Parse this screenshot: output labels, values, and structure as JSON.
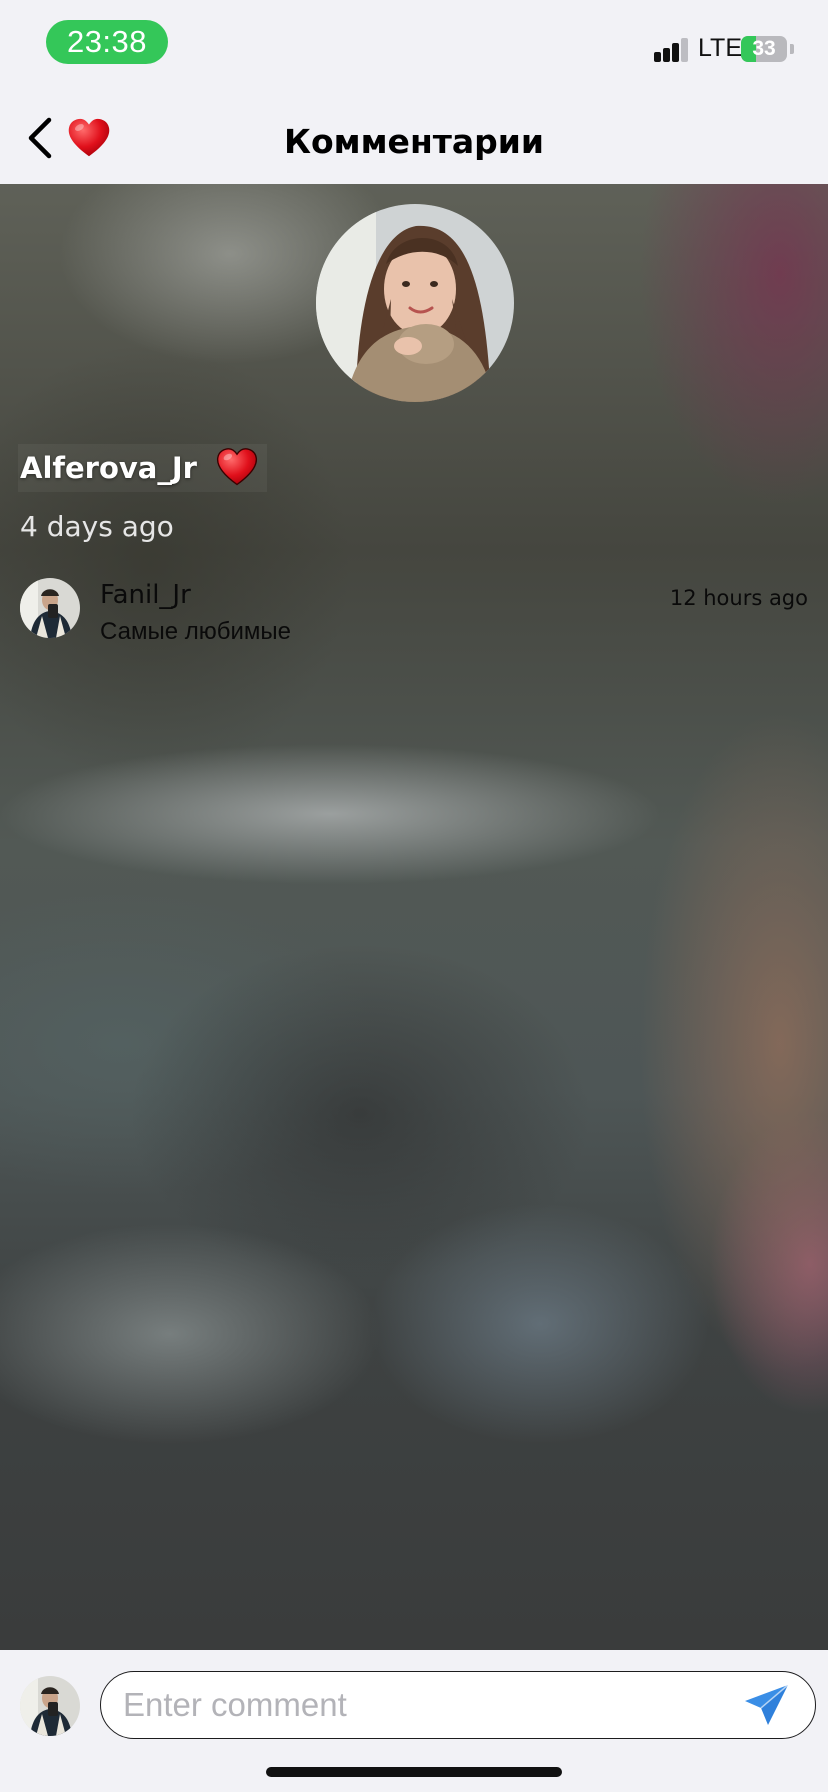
{
  "status_bar": {
    "time": "23:38",
    "network": "LTE",
    "battery_level": "33",
    "battery_fraction": 0.33,
    "charging": true,
    "accent_color": "#34c759"
  },
  "nav": {
    "title": "Комментарии",
    "back_icon": "chevron-left-icon",
    "heart_icon": "red-heart-icon"
  },
  "post": {
    "username": "Alferova_Jr",
    "heart_icon": "red-heart-icon",
    "time_ago": "4 days ago"
  },
  "comments": [
    {
      "author": "Fanil_Jr",
      "text": "Самые любимые",
      "time_ago": "12 hours ago"
    }
  ],
  "composer": {
    "placeholder": "Enter comment",
    "value": "",
    "send_icon": "paper-plane-icon",
    "send_color": "#3a8ee6"
  }
}
